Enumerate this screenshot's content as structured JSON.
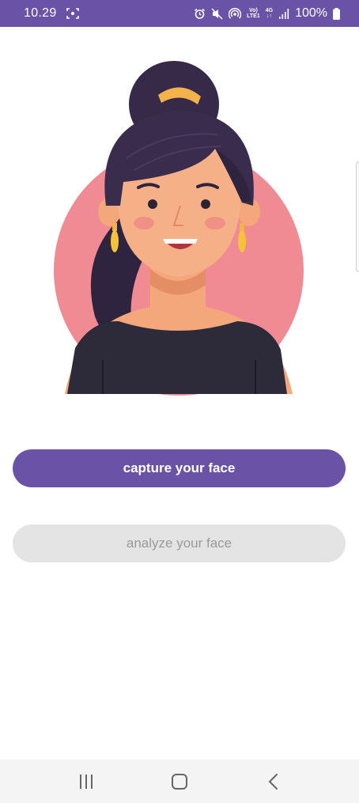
{
  "status_bar": {
    "time": "10.29",
    "network_top": "Vo)",
    "network_bottom": "LTE1",
    "data_top": "4G",
    "data_bottom": "↓↑",
    "battery": "100%",
    "icons": [
      "screenshot-icon",
      "alarm-icon",
      "mute-icon",
      "hotspot-icon",
      "signal-icon",
      "battery-icon"
    ]
  },
  "avatar": {
    "icon": "woman-avatar-illustration"
  },
  "buttons": {
    "capture_label": "capture your face",
    "analyze_label": "analyze your face"
  },
  "colors": {
    "accent": "#6a52a6",
    "disabled_bg": "#e4e4e4",
    "disabled_text": "#9a9a9a",
    "avatar_circle": "#f08a93"
  },
  "nav_bar": {
    "icons": [
      "recent-apps-icon",
      "home-icon",
      "back-icon"
    ]
  }
}
